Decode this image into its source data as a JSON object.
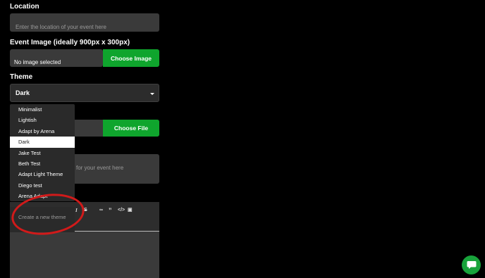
{
  "location": {
    "label": "Location",
    "placeholder": "Enter the location of your event here"
  },
  "event_image": {
    "label": "Event Image (ideally 900px x 300px)",
    "status": "No image selected",
    "button": "Choose Image"
  },
  "theme": {
    "label": "Theme",
    "selected": "Dark",
    "options": [
      "Minimalist",
      "Lightish",
      "Adapt by Arena",
      "Dark",
      "Jake Test",
      "Beth Test",
      "Adapt Light Theme",
      "Diego test",
      "Arena Adapt"
    ],
    "create_label": "Create a new theme"
  },
  "file": {
    "button": "Choose File"
  },
  "description": {
    "placeholder_fragment": "for your event here"
  },
  "colors": {
    "accent_green": "#0fa52d",
    "annotation_red": "#d11a1a"
  },
  "icons": [
    "chevron-down-icon",
    "italic-icon",
    "strikethrough-icon",
    "link-icon",
    "quote-icon",
    "code-icon",
    "image-icon",
    "list-icon",
    "ordered-list-icon",
    "checklist-icon",
    "chat-icon"
  ]
}
